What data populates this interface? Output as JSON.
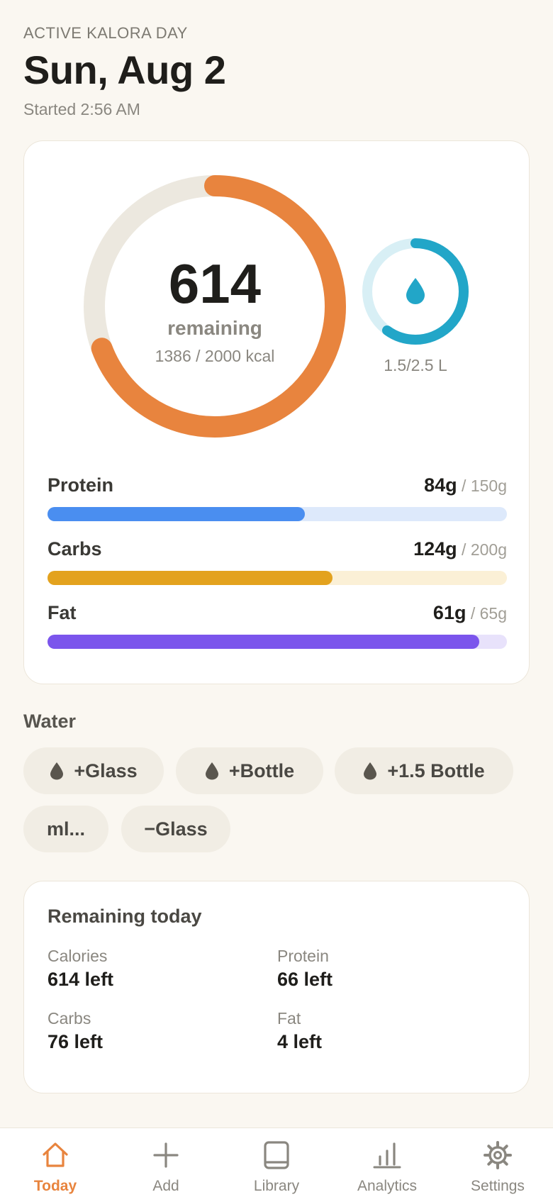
{
  "header": {
    "eyebrow": "ACTIVE KALORA DAY",
    "date": "Sun, Aug 2",
    "started": "Started 2:56 AM"
  },
  "calories": {
    "remaining_number": "614",
    "remaining_label": "remaining",
    "consumed_text": "1386 / 2000 kcal",
    "consumed": 1386,
    "goal": 2000,
    "ring_color": "#e8843e",
    "track_color": "#ece8df"
  },
  "water_ring": {
    "text": "1.5/2.5 L",
    "consumed": 1.5,
    "goal": 2.5,
    "icon": "water-drop-icon",
    "color": "#22a6c8",
    "track_color": "#d8eff5"
  },
  "macros": [
    {
      "name": "Protein",
      "value": "84g",
      "goal": "150g",
      "fraction": 0.56,
      "color": "#4a8ef0",
      "track": "#dde9fb"
    },
    {
      "name": "Carbs",
      "value": "124g",
      "goal": "200g",
      "fraction": 0.62,
      "color": "#e3a21e",
      "track": "#fbf0d6"
    },
    {
      "name": "Fat",
      "value": "61g",
      "goal": "65g",
      "fraction": 0.94,
      "color": "#7b55ec",
      "track": "#e8e2fb"
    }
  ],
  "water": {
    "title": "Water",
    "buttons": [
      {
        "label": "+Glass",
        "icon": "water-drop-icon"
      },
      {
        "label": "+Bottle",
        "icon": "water-drop-icon"
      },
      {
        "label": "+1.5 Bottle",
        "icon": "water-drop-icon"
      },
      {
        "label": "ml..."
      },
      {
        "label": "−Glass"
      }
    ]
  },
  "remaining_today": {
    "title": "Remaining today",
    "items": [
      {
        "label": "Calories",
        "value": "614 left"
      },
      {
        "label": "Protein",
        "value": "66 left"
      },
      {
        "label": "Carbs",
        "value": "76 left"
      },
      {
        "label": "Fat",
        "value": "4 left"
      }
    ]
  },
  "tabs": [
    {
      "label": "Today",
      "icon": "home-icon",
      "active": true
    },
    {
      "label": "Add",
      "icon": "plus-icon",
      "active": false
    },
    {
      "label": "Library",
      "icon": "book-icon",
      "active": false
    },
    {
      "label": "Analytics",
      "icon": "bar-chart-icon",
      "active": false
    },
    {
      "label": "Settings",
      "icon": "gear-icon",
      "active": false
    }
  ],
  "colors": {
    "background": "#faf7f1",
    "accent": "#e8843e",
    "chip_background": "#f1ede4"
  }
}
